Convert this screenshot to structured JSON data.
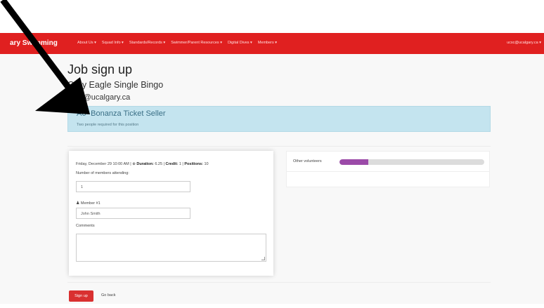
{
  "navbar": {
    "brand": "ary Swimming",
    "menu": [
      "About Us ▾",
      "Squad Info ▾",
      "Standards/Records ▾",
      "Swimmer/Parent Resources ▾",
      "Digital Dives ▾",
      "Members ▾"
    ],
    "user": "ucsc@ucalgary.ca ▾"
  },
  "page": {
    "title": "Job sign up",
    "event_name": "Grey Eagle Single Bingo",
    "event_email": "ucsc@ucalgary.ca"
  },
  "position": {
    "title": "A6- Bonanza Ticket Seller",
    "subtitle": "Two people required for this position"
  },
  "form": {
    "date": "Friday, December 29 10:00 AM |",
    "clock_icon": "⊕",
    "duration_label": "Duration:",
    "duration_value": "6.25",
    "credit_label": "Credit:",
    "credit_value": "1",
    "positions_label": "Positions:",
    "positions_value": "10",
    "members_label": "Number of members attending:",
    "members_value": "1",
    "member_label": "Member #1",
    "member_value": "John Smith",
    "comments_label": "Comments"
  },
  "volunteers": {
    "label": "Other volunteers",
    "progress_fraction": 0.2
  },
  "actions": {
    "signup_label": "Sign up",
    "back_label": "Go back"
  },
  "colors": {
    "navbar": "#e02020",
    "alert": "#c4e4ef",
    "progress_fill": "#9b4aa8",
    "button": "#d93030"
  }
}
